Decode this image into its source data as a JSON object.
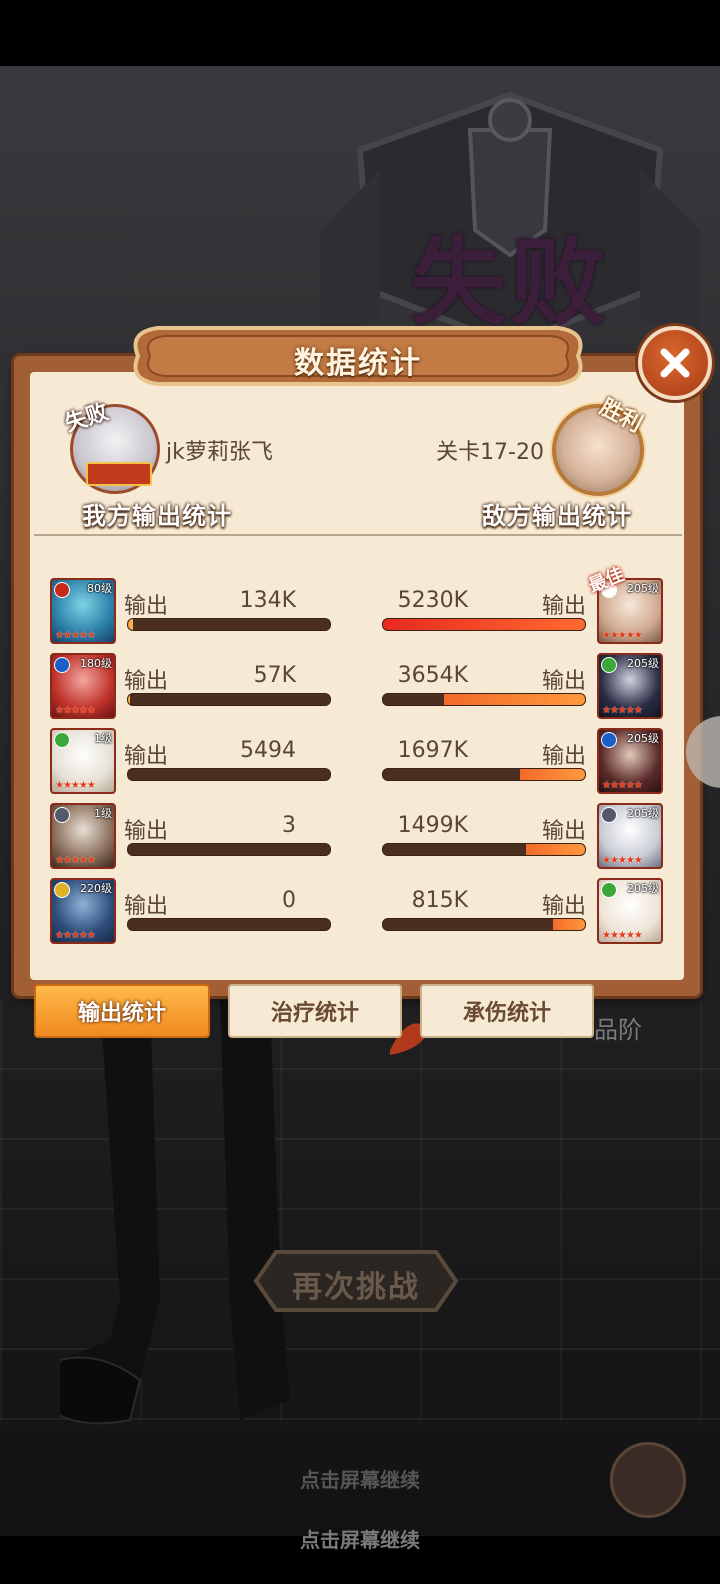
{
  "background": {
    "defeat_title": "失败",
    "bg_text": "品阶"
  },
  "panel": {
    "title": "数据统计",
    "player": {
      "badge": "失败",
      "name": "jk萝莉张飞",
      "stats_title": "我方输出统计"
    },
    "enemy": {
      "badge": "胜利",
      "stage": "关卡17-20",
      "stats_title": "敌方输出统计"
    },
    "best_label": "最佳",
    "rows": [
      {
        "my_level": "80级",
        "my_label": "输出",
        "my_value": "134K",
        "my_fraction": 0.026,
        "en_level": "205级",
        "en_label": "输出",
        "en_value": "5230K",
        "en_fraction": 1.0,
        "my_element_color": "#c7281c",
        "en_element_color": "#ffffff"
      },
      {
        "my_level": "180级",
        "my_label": "输出",
        "my_value": "57K",
        "my_fraction": 0.011,
        "en_level": "205级",
        "en_label": "输出",
        "en_value": "3654K",
        "en_fraction": 0.7,
        "my_element_color": "#1a5fc7",
        "en_element_color": "#3da83a"
      },
      {
        "my_level": "1级",
        "my_label": "输出",
        "my_value": "5494",
        "my_fraction": 0.0,
        "en_level": "205级",
        "en_label": "输出",
        "en_value": "1697K",
        "en_fraction": 0.32,
        "my_element_color": "#3da83a",
        "en_element_color": "#1a5fc7"
      },
      {
        "my_level": "1级",
        "my_label": "输出",
        "my_value": "3",
        "my_fraction": 0.0,
        "en_level": "205级",
        "en_label": "输出",
        "en_value": "1499K",
        "en_fraction": 0.29,
        "my_element_color": "#555a6a",
        "en_element_color": "#555a6a"
      },
      {
        "my_level": "220级",
        "my_label": "输出",
        "my_value": "0",
        "my_fraction": 0.0,
        "en_level": "205级",
        "en_label": "输出",
        "en_value": "815K",
        "en_fraction": 0.16,
        "my_element_color": "#e0b22a",
        "en_element_color": "#3da83a"
      }
    ],
    "star_text": "★★★★★"
  },
  "tabs": {
    "damage": "输出统计",
    "heal": "治疗统计",
    "tank": "承伤统计"
  },
  "retry_button": "再次挑战",
  "hints": {
    "hint1": "点击屏幕继续",
    "hint2": "点击屏幕继续"
  },
  "colors": {
    "panel_border": "#a25e34",
    "panel_bg": "#f7ead4",
    "active_tab": "#f39a2a",
    "bar_track": "#4a2e20",
    "best_bar": "#e82a1f",
    "enemy_bar": "#ff9a3c"
  },
  "icons": {
    "close": "close-x-icon",
    "side": "side-arrow-icon",
    "round": "sword-icon"
  }
}
